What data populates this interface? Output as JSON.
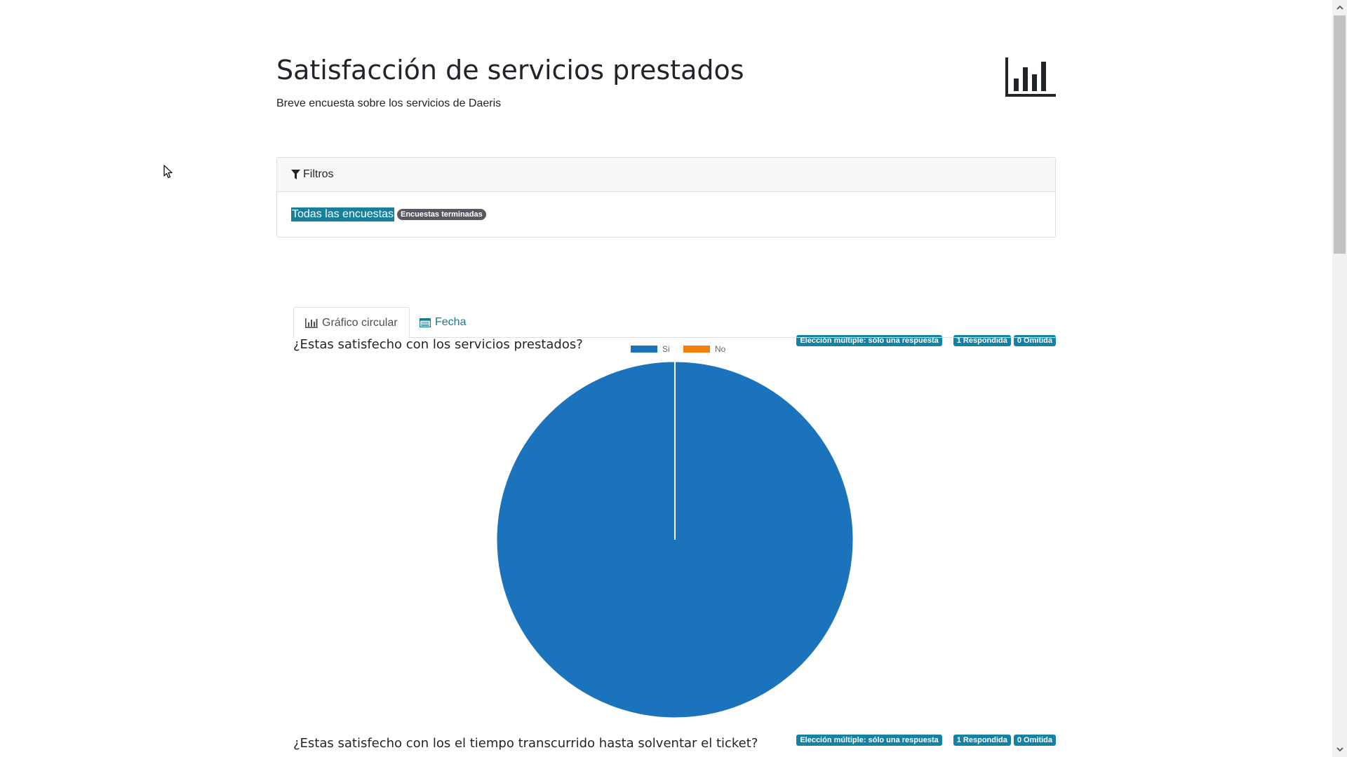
{
  "header": {
    "title": "Satisfacción de servicios prestados",
    "subtitle": "Breve encuesta sobre los servicios de Daeris",
    "logo_icon": "bar-chart-icon"
  },
  "filters": {
    "title": "Filtros",
    "icon": "funnel-icon",
    "selected": "Todas las encuestas",
    "option": "Encuestas terminadas"
  },
  "questions": [
    {
      "title": "¿Estas satisfecho con los servicios prestados?",
      "type_badge": "Elección múltiple: sólo una respuesta",
      "answered_badge": "1 Respondida",
      "skipped_badge": "0 Omitida"
    },
    {
      "title": "¿Estas satisfecho con los el tiempo transcurrido hasta solventar el ticket?",
      "type_badge": "Elección múltiple: sólo una respuesta",
      "answered_badge": "1 Respondida",
      "skipped_badge": "0 Omitida"
    }
  ],
  "tabs": [
    {
      "label": "Gráfico circular",
      "icon": "bar-chart-icon",
      "active": true
    },
    {
      "label": "Fecha",
      "icon": "table-icon",
      "active": false
    }
  ],
  "colors": {
    "si": "#1a73bb",
    "no": "#f27f0c",
    "badge": "#1481a5",
    "highlight": "#17819c"
  },
  "chart_data": {
    "type": "pie",
    "categories": [
      "Si",
      "No"
    ],
    "values": [
      1,
      0
    ],
    "legend": "top"
  }
}
